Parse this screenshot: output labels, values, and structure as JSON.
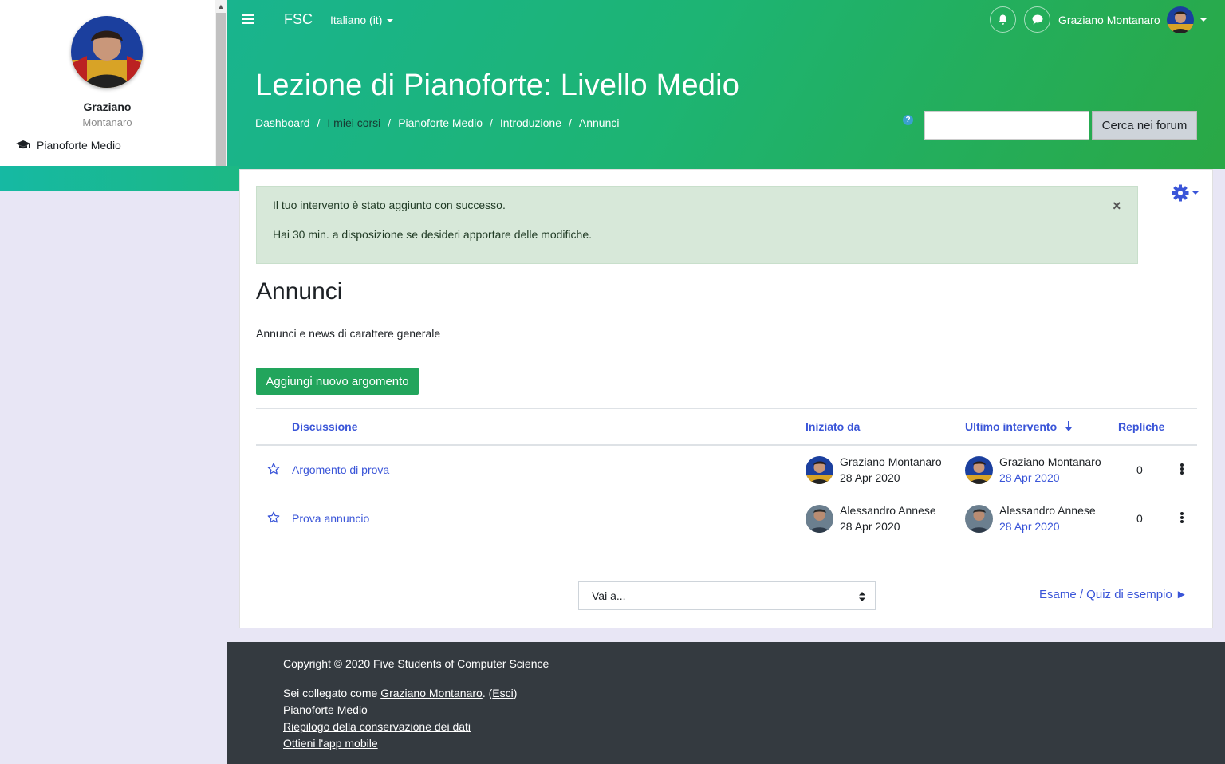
{
  "drawer": {
    "user_first": "Graziano",
    "user_last": "Montanaro",
    "course_link": "Pianoforte Medio"
  },
  "navbar": {
    "brand": "FSC",
    "language": "Italiano (it)",
    "user_name": "Graziano Montanaro"
  },
  "header": {
    "title": "Lezione di Pianoforte: Livello Medio",
    "breadcrumb": [
      "Dashboard",
      "I miei corsi",
      "Pianoforte Medio",
      "Introduzione",
      "Annunci"
    ],
    "search_button": "Cerca nei forum",
    "search_placeholder": "",
    "help_glyph": "?"
  },
  "alert": {
    "line1": "Il tuo intervento è stato aggiunto con successo.",
    "line2": "Hai 30 min. a disposizione se desideri apportare delle modifiche.",
    "close_glyph": "×"
  },
  "forum": {
    "title": "Annunci",
    "description": "Annunci e news di carattere generale",
    "add_button": "Aggiungi nuovo argomento",
    "columns": {
      "discussion": "Discussione",
      "started_by": "Iniziato da",
      "last_post": "Ultimo intervento",
      "replies": "Repliche"
    },
    "rows": [
      {
        "title": "Argomento di prova",
        "starter": "Graziano Montanaro",
        "starter_date": "28 Apr 2020",
        "last_user": "Graziano Montanaro",
        "last_date": "28 Apr 2020",
        "replies": "0"
      },
      {
        "title": "Prova annuncio",
        "starter": "Alessandro Annese",
        "starter_date": "28 Apr 2020",
        "last_user": "Alessandro Annese",
        "last_date": "28 Apr 2020",
        "replies": "0"
      }
    ],
    "goto_select": "Vai a...",
    "next_link": "Esame / Quiz di esempio ►"
  },
  "footer": {
    "copyright": "Copyright © 2020 Five Students of Computer Science",
    "logged_in_prefix": "Sei collegato come ",
    "logged_in_user": "Graziano Montanaro",
    "logout_sep_open": ". (",
    "logout": "Esci",
    "logout_sep_close": ")",
    "course": "Pianoforte Medio",
    "data_retention": "Riepilogo della conservazione dei dati",
    "mobile_app": "Ottieni l'app mobile"
  },
  "colors": {
    "header_start": "#19b48e",
    "header_end": "#2aa845",
    "link": "#3a55d8",
    "primary_button": "#22a55c",
    "alert_bg": "#d7e8d9",
    "footer_bg": "#343a40"
  }
}
